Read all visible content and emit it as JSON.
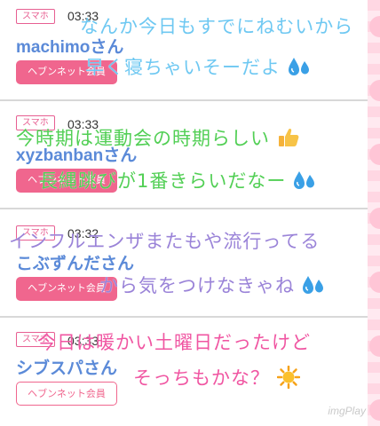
{
  "posts": [
    {
      "device": "スマホ",
      "time": "03:33",
      "username": "machimoさん",
      "member_button": "ヘブンネット会員",
      "overlay": [
        "なんか今日もすでにねむいから",
        "早く寝ちゃいそーだよ"
      ],
      "overlay_color": "#6ec8f2"
    },
    {
      "device": "スマホ",
      "time": "03:33",
      "username": "xyzbanbanさん",
      "member_button": "ヘブンネット会員",
      "overlay": [
        "今時期は運動会の時期らしい",
        "長縄跳びが1番きらいだなー"
      ],
      "overlay_color": "#52cf55"
    },
    {
      "device": "スマホ",
      "time": "03:32",
      "username": "こぶずんださん",
      "member_button": "ヘブンネット会員",
      "overlay": [
        "インフルエンザまたもや流行ってる",
        "から気をつけなきゃね"
      ],
      "overlay_color": "#9a83d8"
    },
    {
      "device": "スマホ",
      "time": "03:33",
      "username": "シブスパさん",
      "member_button": "ヘブンネット会員",
      "overlay": [
        "今日は暖かい土曜日だったけど",
        "そっちもかな？"
      ],
      "overlay_color": "#f056a2"
    }
  ],
  "watermark": "imgPlay",
  "icons": {
    "post1": "sweat-drops-icon",
    "post2_line1": "thumbs-up-icon",
    "post2_line2": "sweat-drops-icon",
    "post3": "sweat-drops-icon",
    "post4": "sun-icon"
  }
}
